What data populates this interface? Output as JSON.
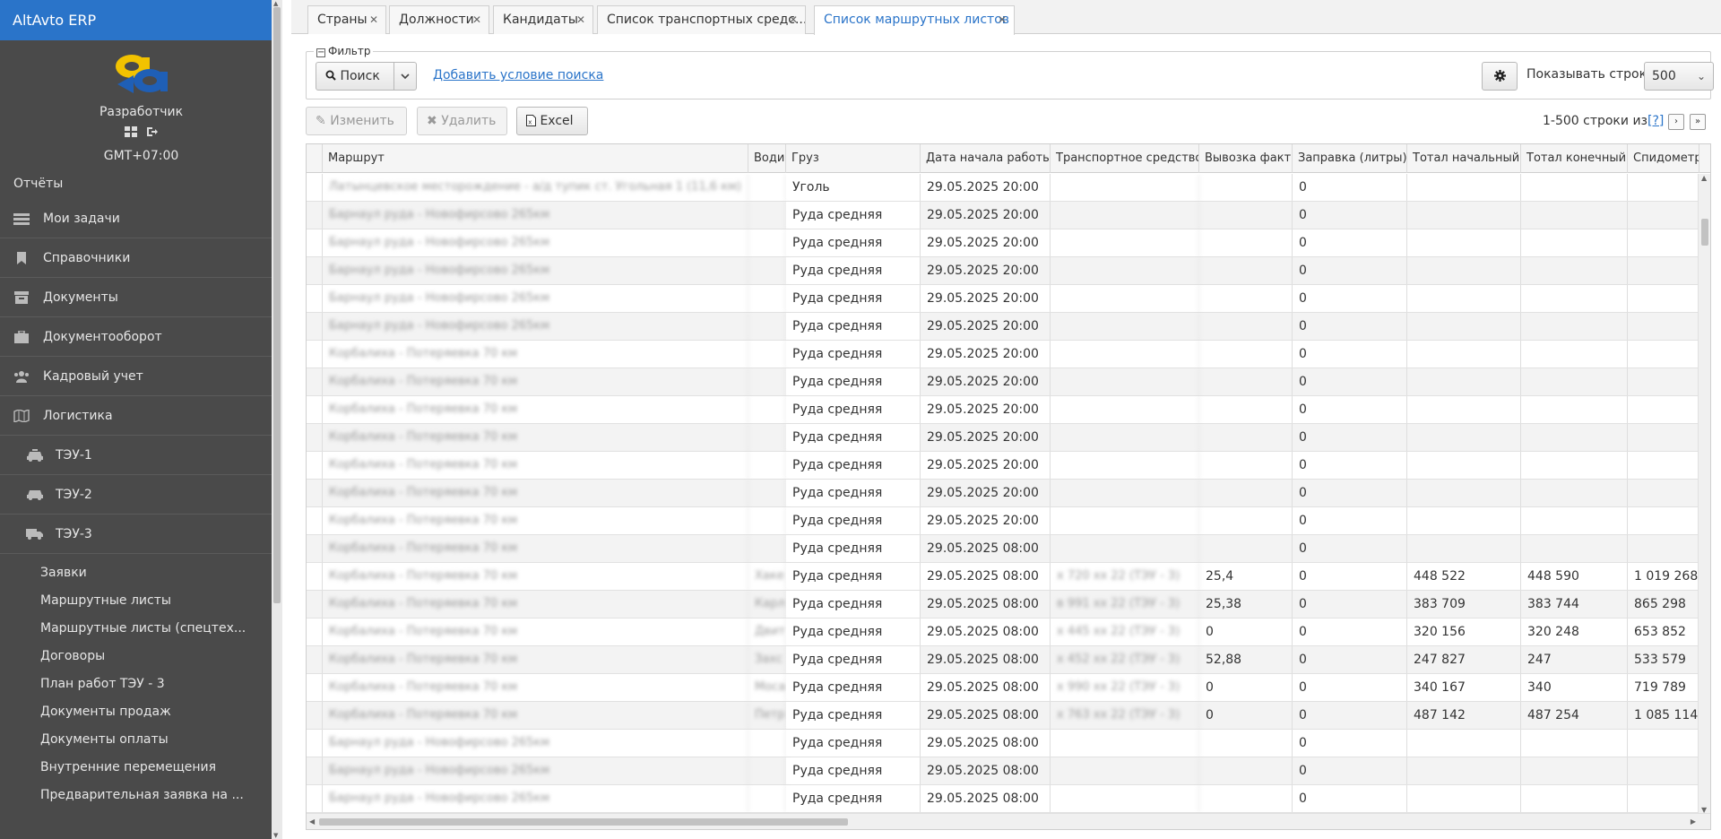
{
  "app": {
    "title": "AltAvto ERP",
    "logo_text": "aa"
  },
  "user": {
    "name": "Разработчик",
    "timezone": "GMT+07:00"
  },
  "sidebar": {
    "reports": "Отчёты",
    "items": [
      {
        "label": "Мои задачи",
        "icon": "tasks-icon"
      },
      {
        "label": "Справочники",
        "icon": "bookmark-icon"
      },
      {
        "label": "Документы",
        "icon": "archive-icon"
      },
      {
        "label": "Документооборот",
        "icon": "briefcase-icon"
      },
      {
        "label": "Кадровый учет",
        "icon": "users-icon"
      },
      {
        "label": "Логистика",
        "icon": "map-icon"
      }
    ],
    "sub_items": [
      {
        "label": "ТЭУ-1",
        "icon": "taxi-icon"
      },
      {
        "label": "ТЭУ-2",
        "icon": "car-icon"
      },
      {
        "label": "ТЭУ-3",
        "icon": "truck-icon"
      }
    ],
    "links": [
      "Заявки",
      "Маршрутные листы",
      "Маршрутные листы (спецтех...",
      "Договоры",
      "План работ ТЭУ - 3",
      "Документы продаж",
      "Документы оплаты",
      "Внутренние перемещения",
      "Предварительная заявка на ..."
    ]
  },
  "tabs": [
    {
      "label": "Страны"
    },
    {
      "label": "Должности"
    },
    {
      "label": "Кандидаты"
    },
    {
      "label": "Список транспортных средс..."
    },
    {
      "label": "Список маршрутных листов"
    }
  ],
  "filter": {
    "legend": "Фильтр",
    "search_label": "Поиск",
    "add_condition": "Добавить условие поиска",
    "rows_label": "Показывать строк",
    "rows_value": "500"
  },
  "toolbar": {
    "edit_label": "Изменить",
    "delete_label": "Удалить",
    "excel_label": "Excel",
    "pager_text": "1-500 строки из",
    "pager_help": "[?]"
  },
  "grid": {
    "columns": [
      "Маршрут",
      "Води",
      "Груз",
      "Дата начала работы",
      "Транспортное средство",
      "Вывозка факт",
      "Заправка (литры)",
      "Тотал начальный",
      "Тотал конечный",
      "Спидометр на"
    ],
    "rows": [
      [
        "Латынцевское месторождение - a/д тупик ст. Угольная 1 (11,6 км)",
        "",
        "Уголь",
        "29.05.2025 20:00",
        "",
        "",
        "0",
        "",
        "",
        ""
      ],
      [
        "Барнаул руда - Новофирсово 265км",
        "",
        "Руда средняя",
        "29.05.2025 20:00",
        "",
        "",
        "0",
        "",
        "",
        ""
      ],
      [
        "Барнаул руда - Новофирсово 265км",
        "",
        "Руда средняя",
        "29.05.2025 20:00",
        "",
        "",
        "0",
        "",
        "",
        ""
      ],
      [
        "Барнаул руда - Новофирсово 265км",
        "",
        "Руда средняя",
        "29.05.2025 20:00",
        "",
        "",
        "0",
        "",
        "",
        ""
      ],
      [
        "Барнаул руда - Новофирсово 265км",
        "",
        "Руда средняя",
        "29.05.2025 20:00",
        "",
        "",
        "0",
        "",
        "",
        ""
      ],
      [
        "Барнаул руда - Новофирсово 265км",
        "",
        "Руда средняя",
        "29.05.2025 20:00",
        "",
        "",
        "0",
        "",
        "",
        ""
      ],
      [
        "Корбалиха - Потеряевка 70 км",
        "",
        "Руда средняя",
        "29.05.2025 20:00",
        "",
        "",
        "0",
        "",
        "",
        ""
      ],
      [
        "Корбалиха - Потеряевка 70 км",
        "",
        "Руда средняя",
        "29.05.2025 20:00",
        "",
        "",
        "0",
        "",
        "",
        ""
      ],
      [
        "Корбалиха - Потеряевка 70 км",
        "",
        "Руда средняя",
        "29.05.2025 20:00",
        "",
        "",
        "0",
        "",
        "",
        ""
      ],
      [
        "Корбалиха - Потеряевка 70 км",
        "",
        "Руда средняя",
        "29.05.2025 20:00",
        "",
        "",
        "0",
        "",
        "",
        ""
      ],
      [
        "Корбалиха - Потеряевка 70 км",
        "",
        "Руда средняя",
        "29.05.2025 20:00",
        "",
        "",
        "0",
        "",
        "",
        ""
      ],
      [
        "Корбалиха - Потеряевка 70 км",
        "",
        "Руда средняя",
        "29.05.2025 20:00",
        "",
        "",
        "0",
        "",
        "",
        ""
      ],
      [
        "Корбалиха - Потеряевка 70 км",
        "",
        "Руда средняя",
        "29.05.2025 20:00",
        "",
        "",
        "0",
        "",
        "",
        ""
      ],
      [
        "Корбалиха - Потеряевка 70 км",
        "",
        "Руда средняя",
        "29.05.2025 08:00",
        "",
        "",
        "0",
        "",
        "",
        ""
      ],
      [
        "Корбалиха - Потеряевка 70 км",
        "Хаке",
        "Руда средняя",
        "29.05.2025 08:00",
        "х 720 хх 22 (ТЭУ - 3)",
        "25,4",
        "0",
        "448 522",
        "448 590",
        "1 019 268"
      ],
      [
        "Корбалиха - Потеряевка 70 км",
        "Карл",
        "Руда средняя",
        "29.05.2025 08:00",
        "в 991 хх 22 (ТЭУ - 3)",
        "25,38",
        "0",
        "383 709",
        "383 744",
        "865 298"
      ],
      [
        "Корбалиха - Потеряевка 70 км",
        "Двит",
        "Руда средняя",
        "29.05.2025 08:00",
        "х 445 хх 22 (ТЭУ - 3)",
        "0",
        "0",
        "320 156",
        "320 248",
        "653 852"
      ],
      [
        "Корбалиха - Потеряевка 70 км",
        "Захс",
        "Руда средняя",
        "29.05.2025 08:00",
        "х 452 хх 22 (ТЭУ - 3)",
        "52,88",
        "0",
        "247 827",
        "247",
        "533 579"
      ],
      [
        "Корбалиха - Потеряевка 70 км",
        "Моса",
        "Руда средняя",
        "29.05.2025 08:00",
        "х 990 хх 22 (ТЭУ - 3)",
        "0",
        "0",
        "340 167",
        "340",
        "719 789"
      ],
      [
        "Корбалиха - Потеряевка 70 км",
        "Петр",
        "Руда средняя",
        "29.05.2025 08:00",
        "х 763 хх 22 (ТЭУ - 3)",
        "0",
        "0",
        "487 142",
        "487 254",
        "1 085 114"
      ],
      [
        "Барнаул руда - Новофирсово 265км",
        "",
        "Руда средняя",
        "29.05.2025 08:00",
        "",
        "",
        "0",
        "",
        "",
        ""
      ],
      [
        "Барнаул руда - Новофирсово 265км",
        "",
        "Руда средняя",
        "29.05.2025 08:00",
        "",
        "",
        "0",
        "",
        "",
        ""
      ],
      [
        "Барнаул руда - Новофирсово 265км",
        "",
        "Руда средняя",
        "29.05.2025 08:00",
        "",
        "",
        "0",
        "",
        "",
        ""
      ]
    ]
  },
  "colors": {
    "accent": "#2a74c9",
    "sidebar_bg": "#4a4a4a",
    "logo_yellow": "#f2c200",
    "logo_blue": "#1f5fb6"
  }
}
